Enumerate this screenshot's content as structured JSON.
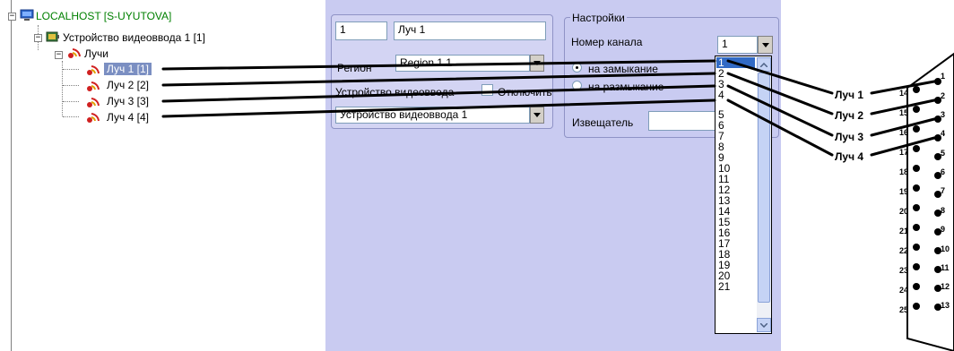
{
  "tree": {
    "root_label": "LOCALHOST [S-UYUTOVA]",
    "device_label": "Устройство видеоввода 1 [1]",
    "rays_folder_label": "Лучи",
    "items": [
      {
        "label": "Луч 1 [1]",
        "selected": true
      },
      {
        "label": "Луч 2 [2]",
        "selected": false
      },
      {
        "label": "Луч 3 [3]",
        "selected": false
      },
      {
        "label": "Луч 4 [4]",
        "selected": false
      }
    ]
  },
  "props": {
    "id_value": "1",
    "name_value": "Луч 1",
    "region_label": "Регион",
    "region_value": "Region 1.1",
    "device_label": "Устройство видеоввода",
    "disable_label": "Отключить",
    "device_value": "Устройство видеоввода 1"
  },
  "settings": {
    "group_title": "Настройки",
    "channel_label": "Номер канала",
    "channel_value": "1",
    "on_close_label": "на замыкание",
    "on_open_label": "на размыкание",
    "detector_label": "Извещатель",
    "dropdown_options": [
      "1",
      "2",
      "3",
      "4",
      "5",
      "6",
      "7",
      "8",
      "9",
      "10",
      "11",
      "12",
      "13",
      "14",
      "15",
      "16",
      "17",
      "18",
      "19",
      "20",
      "21"
    ]
  },
  "connector": {
    "ray_labels": [
      "Луч 1",
      "Луч 2",
      "Луч 3",
      "Луч 4"
    ],
    "top_pins": [
      "1",
      "2",
      "3",
      "4",
      "5",
      "6",
      "7",
      "8",
      "9",
      "10",
      "11",
      "12",
      "13"
    ],
    "bottom_pins": [
      "14",
      "15",
      "16",
      "17",
      "18",
      "19",
      "20",
      "21",
      "22",
      "23",
      "24",
      "25"
    ]
  },
  "colors": {
    "panel_bg": "#c9cbf1",
    "selection": "#316ac5",
    "tree_root": "#008000"
  }
}
